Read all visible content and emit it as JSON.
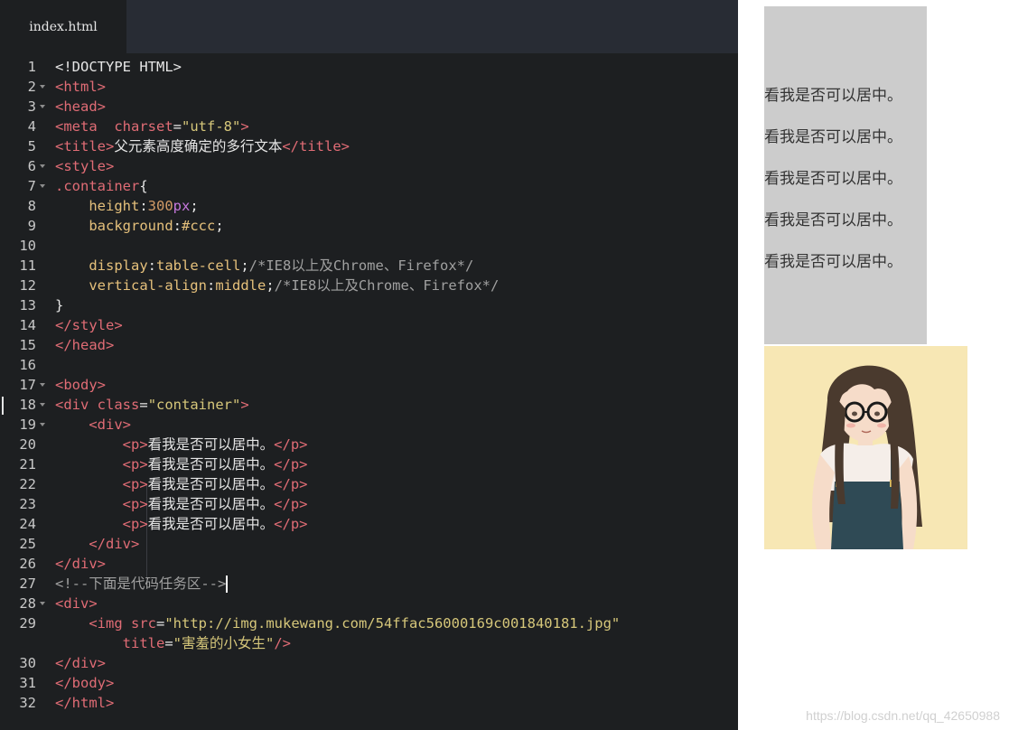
{
  "editor": {
    "tab_title": "index.html",
    "fold_lines": [
      2,
      3,
      6,
      7,
      17,
      18,
      19,
      28
    ],
    "lines": [
      [
        [
          "pl",
          "<!DOCTYPE HTML>"
        ]
      ],
      [
        [
          "tg",
          "<html>"
        ]
      ],
      [
        [
          "tg",
          "<head>"
        ]
      ],
      [
        [
          "tg",
          "<meta  "
        ],
        [
          "at",
          "charset"
        ],
        [
          "pl",
          "="
        ],
        [
          "st",
          "\"utf-8\""
        ],
        [
          "tg",
          ">"
        ]
      ],
      [
        [
          "tg",
          "<title>"
        ],
        [
          "pl",
          "父元素高度确定的多行文本"
        ],
        [
          "tg",
          "</title>"
        ]
      ],
      [
        [
          "tg",
          "<style>"
        ]
      ],
      [
        [
          "tg",
          ".container"
        ],
        [
          "pl",
          "{"
        ]
      ],
      [
        [
          "pl",
          "    "
        ],
        [
          "pr",
          "height"
        ],
        [
          "pl",
          ":"
        ],
        [
          "nm",
          "300"
        ],
        [
          "kw",
          "px"
        ],
        [
          "pl",
          ";"
        ]
      ],
      [
        [
          "pl",
          "    "
        ],
        [
          "pr",
          "background"
        ],
        [
          "pl",
          ":"
        ],
        [
          "vl",
          "#ccc"
        ],
        [
          "pl",
          ";"
        ]
      ],
      [],
      [
        [
          "pl",
          "    "
        ],
        [
          "pr",
          "display"
        ],
        [
          "pl",
          ":"
        ],
        [
          "vl",
          "table-cell"
        ],
        [
          "pl",
          ";"
        ],
        [
          "cm",
          "/*IE8以上及Chrome、Firefox*/"
        ]
      ],
      [
        [
          "pl",
          "    "
        ],
        [
          "pr",
          "vertical-align"
        ],
        [
          "pl",
          ":"
        ],
        [
          "vl",
          "middle"
        ],
        [
          "pl",
          ";"
        ],
        [
          "cm",
          "/*IE8以上及Chrome、Firefox*/"
        ]
      ],
      [
        [
          "pl",
          "}"
        ]
      ],
      [
        [
          "tg",
          "</style>"
        ]
      ],
      [
        [
          "tg",
          "</head>"
        ]
      ],
      [],
      [
        [
          "tg",
          "<body>"
        ]
      ],
      [
        [
          "tg",
          "<div "
        ],
        [
          "at",
          "class"
        ],
        [
          "pl",
          "="
        ],
        [
          "st",
          "\"container\""
        ],
        [
          "tg",
          ">"
        ]
      ],
      [
        [
          "pl",
          "    "
        ],
        [
          "tg",
          "<div>"
        ]
      ],
      [
        [
          "pl",
          "        "
        ],
        [
          "tg",
          "<p>"
        ],
        [
          "pl",
          "看我是否可以居中。"
        ],
        [
          "tg",
          "</p>"
        ]
      ],
      [
        [
          "pl",
          "        "
        ],
        [
          "tg",
          "<p>"
        ],
        [
          "pl",
          "看我是否可以居中。"
        ],
        [
          "tg",
          "</p>"
        ]
      ],
      [
        [
          "pl",
          "        "
        ],
        [
          "tg",
          "<p>"
        ],
        [
          "pl",
          "看我是否可以居中。"
        ],
        [
          "tg",
          "</p>"
        ]
      ],
      [
        [
          "pl",
          "        "
        ],
        [
          "tg",
          "<p>"
        ],
        [
          "pl",
          "看我是否可以居中。"
        ],
        [
          "tg",
          "</p>"
        ]
      ],
      [
        [
          "pl",
          "        "
        ],
        [
          "tg",
          "<p>"
        ],
        [
          "pl",
          "看我是否可以居中。"
        ],
        [
          "tg",
          "</p>"
        ]
      ],
      [
        [
          "pl",
          "    "
        ],
        [
          "tg",
          "</div>"
        ]
      ],
      [
        [
          "tg",
          "</div>"
        ]
      ],
      [
        [
          "cm",
          "<!--下面是代码任务区-->"
        ],
        [
          "caret",
          ""
        ]
      ],
      [
        [
          "tg",
          "<div>"
        ]
      ],
      [
        [
          "pl",
          "    "
        ],
        [
          "tg",
          "<img "
        ],
        [
          "at",
          "src"
        ],
        [
          "pl",
          "="
        ],
        [
          "st",
          "\"http://img.mukewang.com/54ffac56000169c001840181.jpg\""
        ]
      ],
      [
        [
          "pl",
          "        "
        ],
        [
          "at",
          "title"
        ],
        [
          "pl",
          "="
        ],
        [
          "st",
          "\"害羞的小女生\""
        ],
        [
          "tg",
          "/>"
        ]
      ],
      [
        [
          "tg",
          "</div>"
        ]
      ],
      [
        [
          "tg",
          "</body>"
        ]
      ],
      [
        [
          "tg",
          "</html>"
        ]
      ]
    ],
    "line_numbers": [
      "1",
      "2",
      "3",
      "4",
      "5",
      "6",
      "7",
      "8",
      "9",
      "10",
      "11",
      "12",
      "13",
      "14",
      "15",
      "16",
      "17",
      "18",
      "19",
      "20",
      "21",
      "22",
      "23",
      "24",
      "25",
      "26",
      "27",
      "28",
      "29",
      "",
      "30",
      "31",
      "32"
    ]
  },
  "preview": {
    "paragraphs": [
      "看我是否可以居中。",
      "看我是否可以居中。",
      "看我是否可以居中。",
      "看我是否可以居中。",
      "看我是否可以居中。"
    ],
    "image_alt": "害羞的小女生",
    "watermark": "https://blog.csdn.net/qq_42650988"
  },
  "colors": {
    "editor_bg": "#1d1f21",
    "tabbar_bg": "#282c34",
    "tag": "#e06c75",
    "string": "#d6c77a",
    "property": "#e5c07b",
    "comment": "#a0a0a0",
    "container_bg": "#cccccc"
  }
}
